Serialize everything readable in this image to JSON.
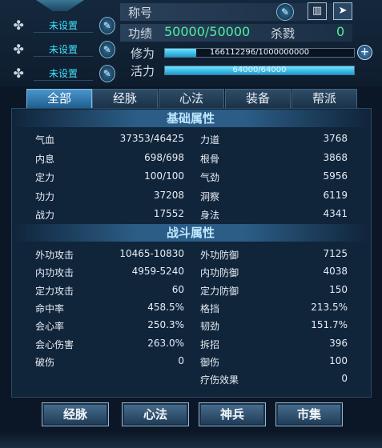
{
  "equip_slots": [
    "未设置",
    "未设置",
    "未设置"
  ],
  "header": {
    "title_label": "称号",
    "merit_label": "功绩",
    "merit_value": "50000/50000",
    "kill_label": "杀戮",
    "kill_value": "0",
    "cultivation_label": "修为",
    "cultivation_text": "166112296/1000000000",
    "cultivation_fraction": 0.166,
    "vitality_label": "活力",
    "vitality_text": "64000/64000",
    "vitality_fraction": 1.0
  },
  "tabs": [
    "全部",
    "经脉",
    "心法",
    "装备",
    "帮派"
  ],
  "basic": {
    "title": "基础属性",
    "rows": [
      {
        "l": "气血",
        "lv": "37353/46425",
        "r": "力道",
        "rv": "3768"
      },
      {
        "l": "内息",
        "lv": "698/698",
        "r": "根骨",
        "rv": "3868"
      },
      {
        "l": "定力",
        "lv": "100/100",
        "r": "气劲",
        "rv": "5956"
      },
      {
        "l": "功力",
        "lv": "37208",
        "r": "洞察",
        "rv": "6119"
      },
      {
        "l": "战力",
        "lv": "17552",
        "r": "身法",
        "rv": "4341"
      }
    ]
  },
  "combat": {
    "title": "战斗属性",
    "rows": [
      {
        "l": "外功攻击",
        "lv": "10465-10830",
        "r": "外功防御",
        "rv": "7125"
      },
      {
        "l": "内功攻击",
        "lv": "4959-5240",
        "r": "内功防御",
        "rv": "4038"
      },
      {
        "l": "定力攻击",
        "lv": "60",
        "r": "定力防御",
        "rv": "150"
      },
      {
        "l": "命中率",
        "lv": "458.5%",
        "r": "格挡",
        "rv": "213.5%"
      },
      {
        "l": "会心率",
        "lv": "250.3%",
        "r": "韧劲",
        "rv": "151.7%"
      },
      {
        "l": "会心伤害",
        "lv": "263.0%",
        "r": "拆招",
        "rv": "396"
      },
      {
        "l": "破伤",
        "lv": "0",
        "r": "御伤",
        "rv": "100"
      },
      {
        "l": "",
        "lv": "",
        "r": "疗伤效果",
        "rv": "0"
      }
    ]
  },
  "bottom_buttons": [
    "经脉",
    "心法",
    "神兵",
    "市集"
  ],
  "icons": {
    "slot": "fan-icon",
    "edit": "pen-icon",
    "calendar": "calendar-icon",
    "share": "share-icon",
    "plus": "plus-icon"
  },
  "colors": {
    "accent": "#3fe3ff",
    "merit": "#4ef0a0",
    "active_tab": "#4a95cc"
  }
}
